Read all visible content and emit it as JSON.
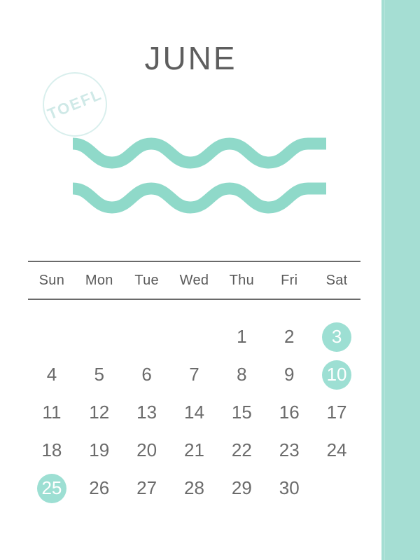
{
  "colors": {
    "accent": "#a5ded3",
    "highlight": "#9ddfd3",
    "wave": "#8fd9c9",
    "text": "#6b6b6b",
    "title": "#5e5e5e",
    "stamp": "#d6eeec",
    "background": "#ffffff"
  },
  "header": {
    "month_title": "JUNE",
    "stamp_text": "TOEFL"
  },
  "calendar": {
    "weekdays": [
      "Sun",
      "Mon",
      "Tue",
      "Wed",
      "Thu",
      "Fri",
      "Sat"
    ],
    "weeks": [
      [
        {
          "day": "",
          "highlight": false
        },
        {
          "day": "",
          "highlight": false
        },
        {
          "day": "",
          "highlight": false
        },
        {
          "day": "",
          "highlight": false
        },
        {
          "day": "1",
          "highlight": false
        },
        {
          "day": "2",
          "highlight": false
        },
        {
          "day": "3",
          "highlight": true
        }
      ],
      [
        {
          "day": "4",
          "highlight": false
        },
        {
          "day": "5",
          "highlight": false
        },
        {
          "day": "6",
          "highlight": false
        },
        {
          "day": "7",
          "highlight": false
        },
        {
          "day": "8",
          "highlight": false
        },
        {
          "day": "9",
          "highlight": false
        },
        {
          "day": "10",
          "highlight": true
        }
      ],
      [
        {
          "day": "11",
          "highlight": false
        },
        {
          "day": "12",
          "highlight": false
        },
        {
          "day": "13",
          "highlight": false
        },
        {
          "day": "14",
          "highlight": false
        },
        {
          "day": "15",
          "highlight": false
        },
        {
          "day": "16",
          "highlight": false
        },
        {
          "day": "17",
          "highlight": false
        }
      ],
      [
        {
          "day": "18",
          "highlight": false
        },
        {
          "day": "19",
          "highlight": false
        },
        {
          "day": "20",
          "highlight": false
        },
        {
          "day": "21",
          "highlight": false
        },
        {
          "day": "22",
          "highlight": false
        },
        {
          "day": "23",
          "highlight": false
        },
        {
          "day": "24",
          "highlight": false
        }
      ],
      [
        {
          "day": "25",
          "highlight": true
        },
        {
          "day": "26",
          "highlight": false
        },
        {
          "day": "27",
          "highlight": false
        },
        {
          "day": "28",
          "highlight": false
        },
        {
          "day": "29",
          "highlight": false
        },
        {
          "day": "30",
          "highlight": false
        },
        {
          "day": "",
          "highlight": false
        }
      ]
    ],
    "highlighted_days": [
      "3",
      "10",
      "25"
    ]
  },
  "decorations": {
    "wave_count": 2,
    "accent_bar_position": "right"
  }
}
